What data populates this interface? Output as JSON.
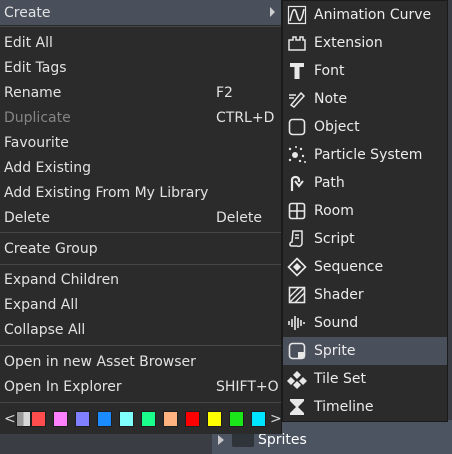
{
  "context_menu": {
    "items": [
      {
        "label": "Create",
        "has_submenu": true
      },
      {
        "label": "Edit All"
      },
      {
        "label": "Edit Tags"
      },
      {
        "label": "Rename",
        "shortcut": "F2"
      },
      {
        "label": "Duplicate",
        "shortcut": "CTRL+D",
        "disabled": true
      },
      {
        "label": "Favourite"
      },
      {
        "label": "Add Existing"
      },
      {
        "label": "Add Existing From My Library"
      },
      {
        "label": "Delete",
        "shortcut": "Delete"
      },
      {
        "label": "Create Group"
      },
      {
        "label": "Expand Children"
      },
      {
        "label": "Expand All"
      },
      {
        "label": "Collapse All"
      },
      {
        "label": "Open in new Asset Browser"
      },
      {
        "label": "Open In Explorer",
        "shortcut": "SHIFT+O"
      }
    ],
    "color_strip": {
      "prev": "<",
      "next": ">",
      "swatches": [
        "none",
        "#ff4d4d",
        "#ff80ff",
        "#8080ff",
        "#1a8cff",
        "#80ffff",
        "#1aff8c",
        "#ffb380",
        "#ff0000",
        "#ffff00",
        "#1ae61a",
        "#00e5ff"
      ]
    }
  },
  "create_submenu": {
    "items": [
      {
        "label": "Animation Curve",
        "icon": "animation-curve-icon"
      },
      {
        "label": "Extension",
        "icon": "extension-icon"
      },
      {
        "label": "Font",
        "icon": "font-icon"
      },
      {
        "label": "Note",
        "icon": "note-icon"
      },
      {
        "label": "Object",
        "icon": "object-icon"
      },
      {
        "label": "Particle System",
        "icon": "particle-system-icon"
      },
      {
        "label": "Path",
        "icon": "path-icon"
      },
      {
        "label": "Room",
        "icon": "room-icon"
      },
      {
        "label": "Script",
        "icon": "script-icon"
      },
      {
        "label": "Sequence",
        "icon": "sequence-icon"
      },
      {
        "label": "Shader",
        "icon": "shader-icon"
      },
      {
        "label": "Sound",
        "icon": "sound-icon"
      },
      {
        "label": "Sprite",
        "icon": "sprite-icon",
        "highlighted": true
      },
      {
        "label": "Tile Set",
        "icon": "tile-set-icon"
      },
      {
        "label": "Timeline",
        "icon": "timeline-icon"
      }
    ]
  },
  "asset_browser": {
    "visible_item": "Sprites"
  },
  "colors": {
    "menu_bg": "#2b2b2b",
    "highlight": "#4a4f5c",
    "disabled_text": "#858585"
  }
}
